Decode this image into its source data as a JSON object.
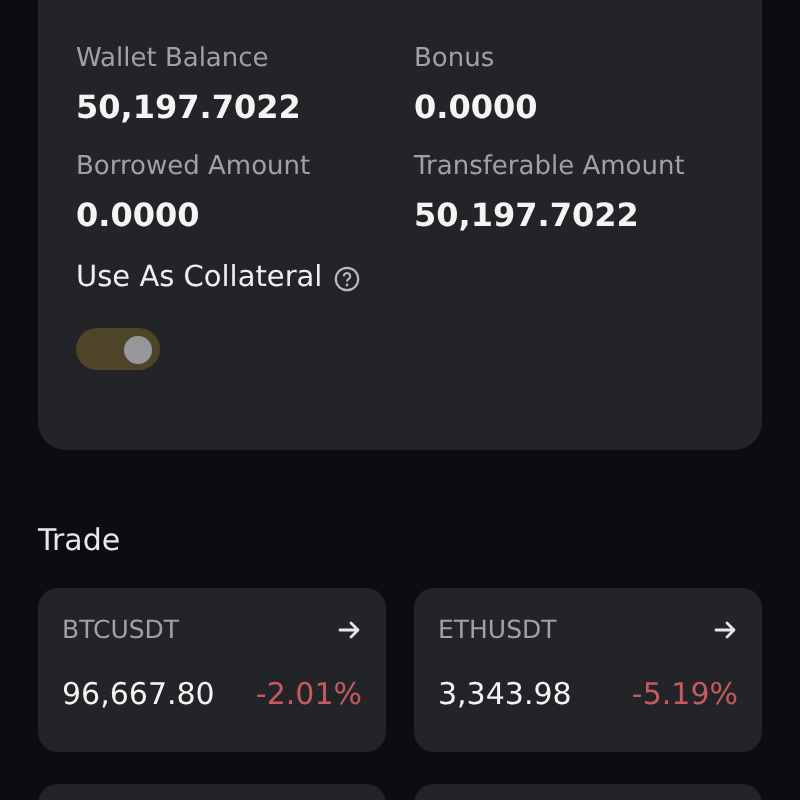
{
  "balance_card": {
    "fields": [
      {
        "label": "Wallet Balance",
        "value": "50,197.7022"
      },
      {
        "label": "Bonus",
        "value": "0.0000"
      },
      {
        "label": "Borrowed Amount",
        "value": "0.0000"
      },
      {
        "label": "Transferable Amount",
        "value": "50,197.7022"
      }
    ],
    "collateral": {
      "label": "Use As Collateral",
      "on": true
    }
  },
  "trade": {
    "title": "Trade",
    "tiles": [
      {
        "kind": "market",
        "symbol": "BTCUSDT",
        "price": "96,667.80",
        "change": "-2.01%",
        "negative": true
      },
      {
        "kind": "market",
        "symbol": "ETHUSDT",
        "price": "3,343.98",
        "change": "-5.19%",
        "negative": true
      },
      {
        "kind": "clipped"
      },
      {
        "kind": "clipped"
      }
    ]
  }
}
